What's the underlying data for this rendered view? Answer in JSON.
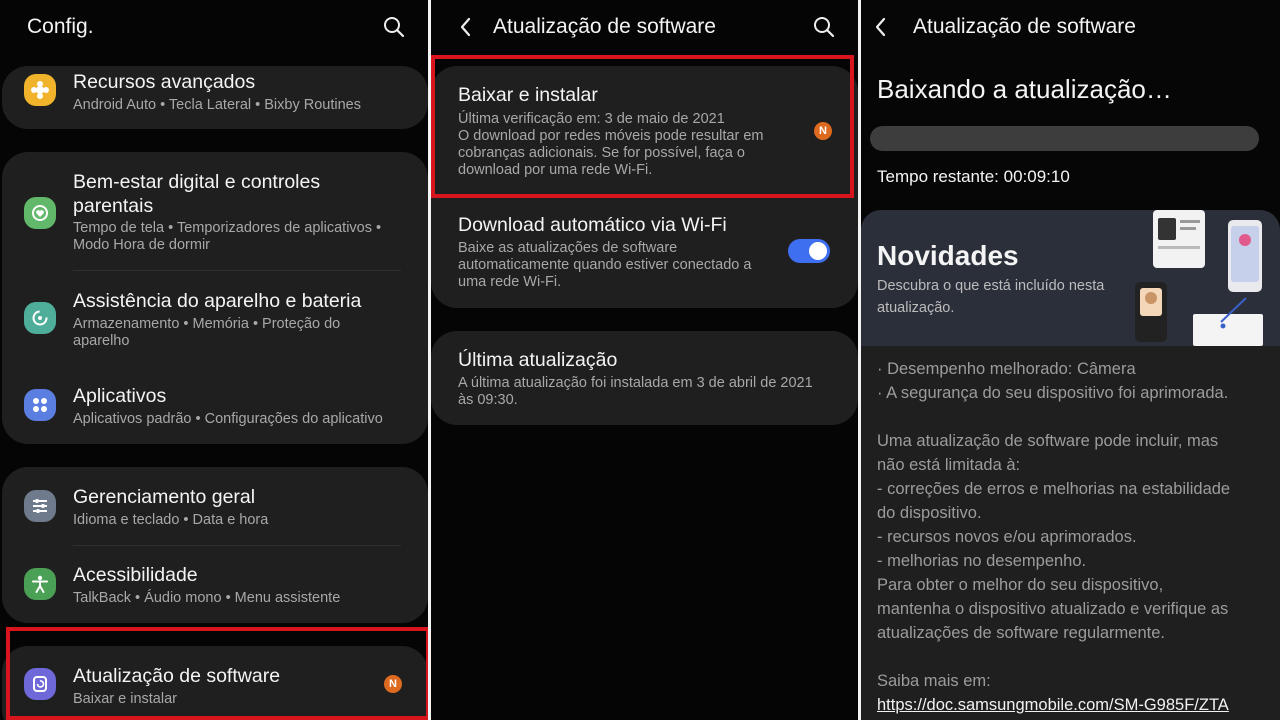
{
  "settings": {
    "title": "Config.",
    "items": [
      {
        "title": "Recursos avançados",
        "sub1": "Android Auto  •  Tecla Lateral  •  Bixby Routines",
        "icon": "plus-icon",
        "color": "#f1b32c"
      },
      {
        "title": "Bem-estar digital e controles",
        "title2": "parentais",
        "sub1": "Tempo de tela  •  Temporizadores de aplicativos  •",
        "sub2": "Modo Hora de dormir",
        "icon": "heart-icon",
        "color": "#61b86a"
      },
      {
        "title": "Assistência do aparelho e bateria",
        "sub1": "Armazenamento  •  Memória  •  Proteção do",
        "sub2": "aparelho",
        "icon": "refresh-icon",
        "color": "#4fae9a"
      },
      {
        "title": "Aplicativos",
        "sub1": "Aplicativos padrão  •  Configurações do aplicativo",
        "icon": "apps-grid-icon",
        "color": "#5b7fe0"
      },
      {
        "title": "Gerenciamento geral",
        "sub1": "Idioma e teclado  •  Data e hora",
        "icon": "sliders-icon",
        "color": "#6f7b8c"
      },
      {
        "title": "Acessibilidade",
        "sub1": "TalkBack  •  Áudio mono  •  Menu assistente",
        "icon": "accessibility-icon",
        "color": "#4aa155"
      },
      {
        "title": "Atualização de software",
        "sub1": "Baixar e instalar",
        "icon": "update-icon",
        "color": "#6e68d8",
        "badge": "N"
      }
    ]
  },
  "software_update": {
    "title": "Atualização de software",
    "download": {
      "title": "Baixar e instalar",
      "lines": [
        "Última verificação em: 3 de maio de 2021",
        "O download por redes móveis pode resultar em",
        "cobranças adicionais. Se for possível, faça o",
        "download por uma rede Wi-Fi."
      ],
      "badge": "N"
    },
    "auto": {
      "title": "Download automático via Wi-Fi",
      "lines": [
        "Baixe as atualizações de software",
        "automaticamente quando estiver conectado a",
        "uma rede Wi-Fi."
      ],
      "toggle_on": true
    },
    "last": {
      "title": "Última atualização",
      "lines": [
        "A última atualização foi instalada em 3 de abril de 2021",
        "às 09:30."
      ]
    }
  },
  "downloading": {
    "title": "Atualização de software",
    "heading": "Baixando a atualização…",
    "progress": 0,
    "remaining": "Tempo restante: 00:09:10",
    "news_title": "Novidades",
    "news_sub1": "Descubra o que está incluído nesta",
    "news_sub2": "atualização.",
    "body": [
      "· Desempenho melhorado: Câmera",
      "· A segurança do seu dispositivo foi aprimorada.",
      "",
      "Uma atualização de software pode incluir, mas",
      "não está limitada à:",
      " - correções de erros e melhorias na estabilidade",
      "do dispositivo.",
      " - recursos novos e/ou aprimorados.",
      " - melhorias no desempenho.",
      "Para obter o melhor do seu dispositivo,",
      "mantenha o dispositivo atualizado e verifique as",
      "atualizações de software regularmente.",
      "",
      "Saiba mais em:"
    ],
    "link": "https://doc.samsungmobile.com/SM-G985F/ZTA"
  }
}
